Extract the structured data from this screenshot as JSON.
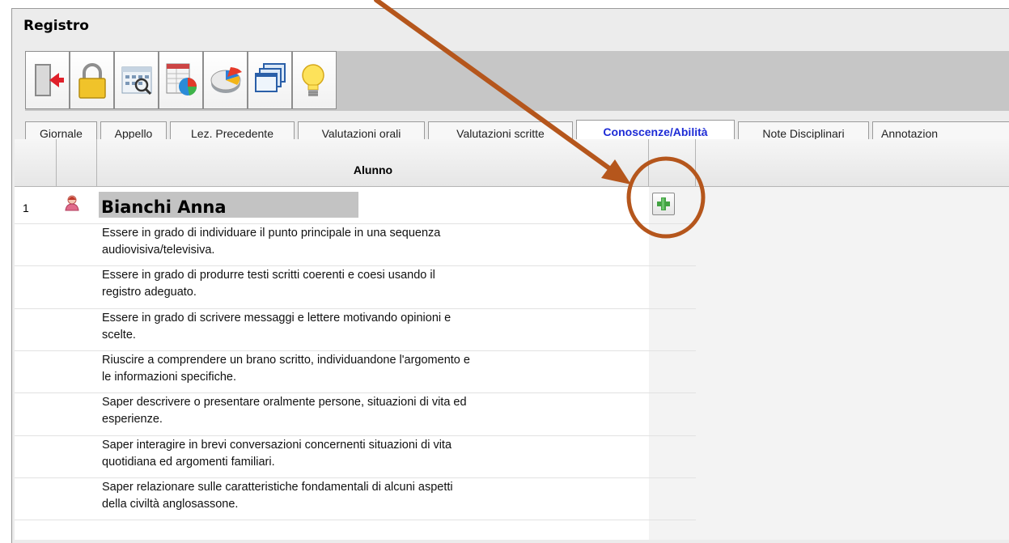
{
  "window": {
    "title": "Registro"
  },
  "toolbar": {
    "buttons": [
      {
        "icon": "exit-door-icon"
      },
      {
        "icon": "padlock-icon"
      },
      {
        "icon": "calendar-search-icon"
      },
      {
        "icon": "table-pie-chart-icon"
      },
      {
        "icon": "pie-chart-icon"
      },
      {
        "icon": "windows-stack-icon"
      },
      {
        "icon": "lightbulb-icon"
      }
    ]
  },
  "tabs": [
    {
      "label": "Giornale",
      "active": false
    },
    {
      "label": "Appello",
      "active": false
    },
    {
      "label": "Lez. Precedente",
      "active": false
    },
    {
      "label": "Valutazioni orali",
      "active": false
    },
    {
      "label": "Valutazioni scritte",
      "active": false
    },
    {
      "label": "Conoscenze/Abilità",
      "active": true
    },
    {
      "label": "Note Disciplinari",
      "active": false
    },
    {
      "label": "Annotazion",
      "active": false
    }
  ],
  "grid": {
    "header": {
      "student_col": "Alunno"
    },
    "student": {
      "number": "1",
      "name": "Bianchi Anna",
      "icon": "female-student-icon"
    },
    "abilities": [
      {
        "line1": "Essere in grado di individuare il punto principale in una sequenza",
        "line2": "audiovisiva/televisiva."
      },
      {
        "line1": "Essere in grado di produrre testi scritti coerenti e coesi usando il",
        "line2": "registro adeguato."
      },
      {
        "line1": "Essere in grado di scrivere messaggi e lettere motivando opinioni e",
        "line2": "scelte."
      },
      {
        "line1": "Riuscire a comprendere un brano scritto, individuandone l'argomento e",
        "line2": "le informazioni specifiche."
      },
      {
        "line1": "Saper descrivere o presentare oralmente persone, situazioni di vita ed",
        "line2": "esperienze."
      },
      {
        "line1": "Saper interagire in brevi conversazioni concernenti situazioni di vita",
        "line2": "quotidiana ed argomenti familiari."
      },
      {
        "line1": "Saper relazionare sulle caratteristiche fondamentali di alcuni aspetti",
        "line2": "della civiltà anglosassone."
      }
    ],
    "add_button": {
      "icon": "green-plus-icon"
    }
  },
  "annotation": {
    "color": "#b5561c"
  }
}
